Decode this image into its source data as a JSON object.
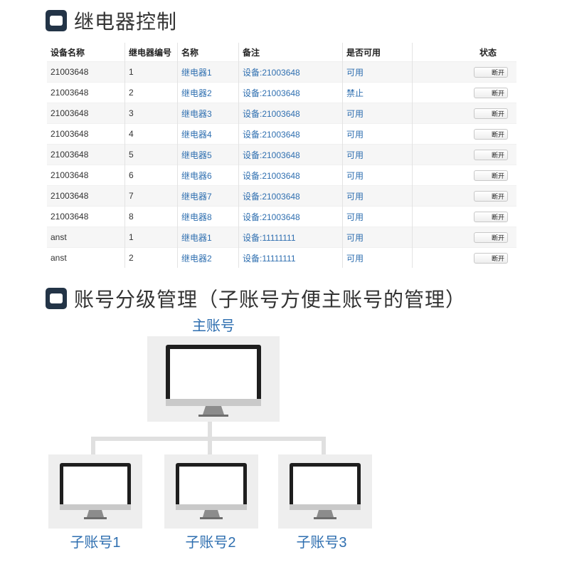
{
  "relay_section": {
    "title": "继电器控制",
    "columns": [
      "设备名称",
      "继电器编号",
      "名称",
      "备注",
      "是否可用",
      "状态"
    ],
    "rows": [
      {
        "device": "21003648",
        "number": "1",
        "name": "继电器1",
        "remark": "设备:21003648",
        "available": "可用",
        "action": "断开"
      },
      {
        "device": "21003648",
        "number": "2",
        "name": "继电器2",
        "remark": "设备:21003648",
        "available": "禁止",
        "action": "断开"
      },
      {
        "device": "21003648",
        "number": "3",
        "name": "继电器3",
        "remark": "设备:21003648",
        "available": "可用",
        "action": "断开"
      },
      {
        "device": "21003648",
        "number": "4",
        "name": "继电器4",
        "remark": "设备:21003648",
        "available": "可用",
        "action": "断开"
      },
      {
        "device": "21003648",
        "number": "5",
        "name": "继电器5",
        "remark": "设备:21003648",
        "available": "可用",
        "action": "断开"
      },
      {
        "device": "21003648",
        "number": "6",
        "name": "继电器6",
        "remark": "设备:21003648",
        "available": "可用",
        "action": "断开"
      },
      {
        "device": "21003648",
        "number": "7",
        "name": "继电器7",
        "remark": "设备:21003648",
        "available": "可用",
        "action": "断开"
      },
      {
        "device": "21003648",
        "number": "8",
        "name": "继电器8",
        "remark": "设备:21003648",
        "available": "可用",
        "action": "断开"
      },
      {
        "device": "anst",
        "number": "1",
        "name": "继电器1",
        "remark": "设备:11111111",
        "available": "可用",
        "action": "断开"
      },
      {
        "device": "anst",
        "number": "2",
        "name": "继电器2",
        "remark": "设备:11111111",
        "available": "可用",
        "action": "断开"
      }
    ]
  },
  "account_section": {
    "title": "账号分级管理（子账号方便主账号的管理）",
    "main_account": "主账号",
    "sub_accounts": [
      "子账号1",
      "子账号2",
      "子账号3"
    ]
  },
  "colors": {
    "accent": "#2f6fb0",
    "bullet": "#233447",
    "panel": "#eeeeee"
  }
}
